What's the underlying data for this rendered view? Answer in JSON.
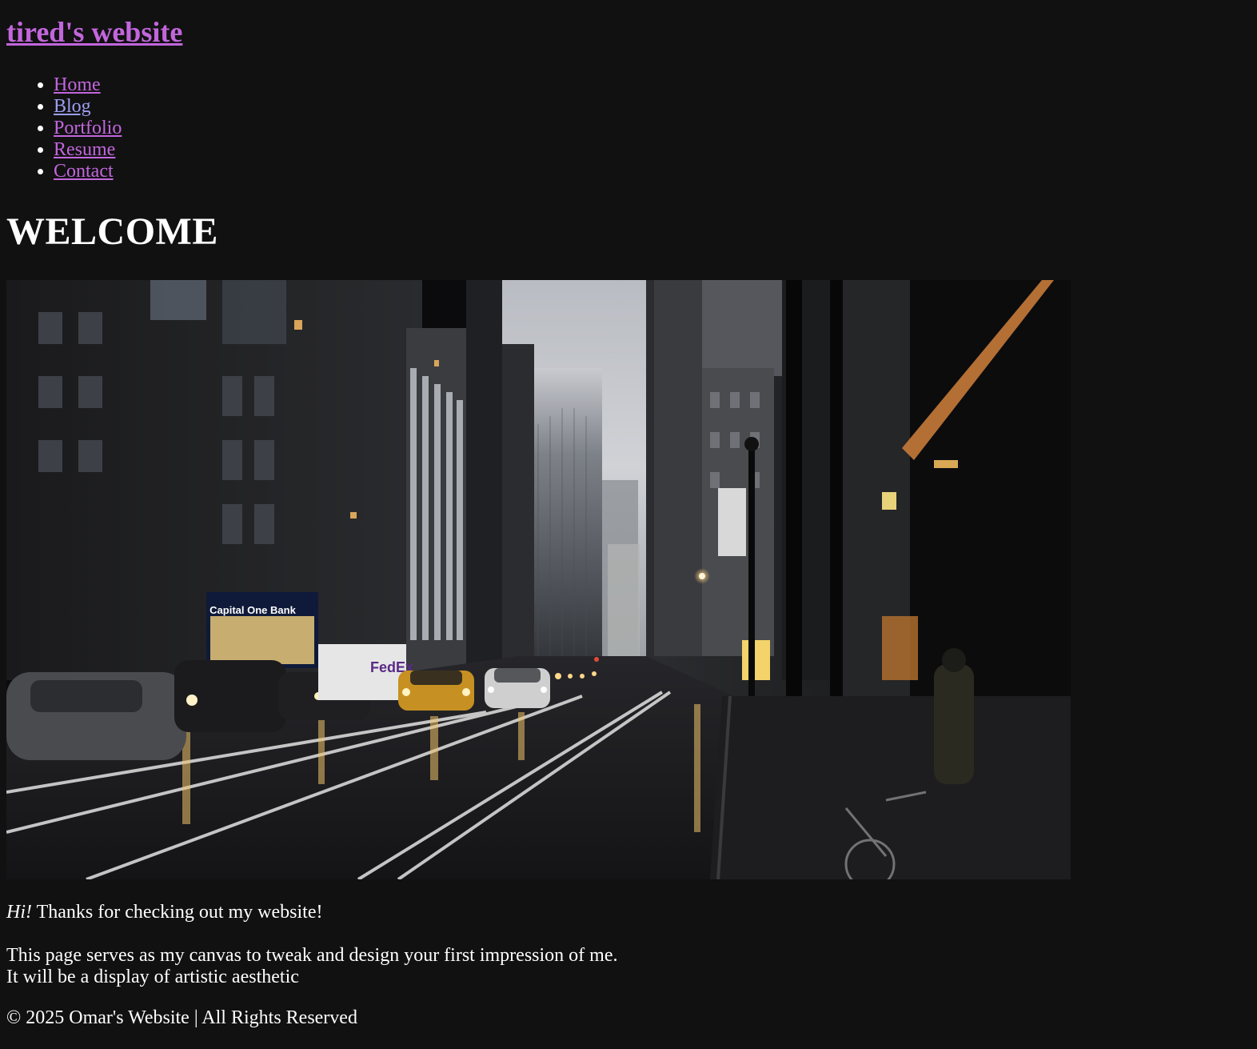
{
  "site": {
    "title": "tired's website"
  },
  "nav": {
    "items": [
      {
        "label": "Home"
      },
      {
        "label": "Blog"
      },
      {
        "label": "Portfolio"
      },
      {
        "label": "Resume"
      },
      {
        "label": "Contact"
      }
    ]
  },
  "main": {
    "heading": "WELCOME",
    "hero_image": {
      "bank_sign": "Capital One Bank",
      "truck_sign": "FedEx"
    },
    "intro_emphasis": "Hi!",
    "intro_rest": " Thanks for checking out my website!",
    "line1": "This page serves as my canvas to tweak and design your first impression of me.",
    "line2": "It will be a display of artistic aesthetic"
  },
  "footer": {
    "text": "© 2025 Omar's Website | All Rights Reserved"
  },
  "colors": {
    "background": "#111111",
    "link": "#c266dd",
    "link_visited": "#9c9ef0",
    "text": "#ffffff"
  }
}
